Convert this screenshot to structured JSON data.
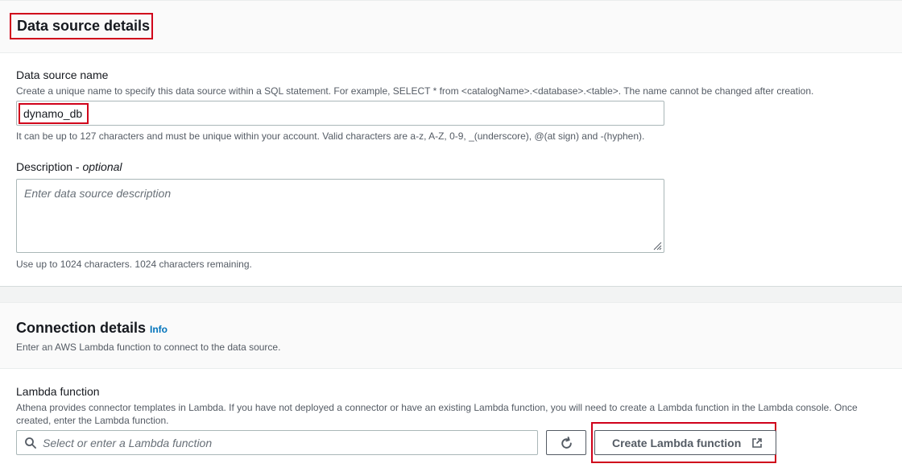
{
  "data_source_details": {
    "title": "Data source details",
    "name_label": "Data source name",
    "name_description": "Create a unique name to specify this data source within a SQL statement. For example, SELECT * from <catalogName>.<database>.<table>. The name cannot be changed after creation.",
    "name_value": "dynamo_db",
    "name_hint": "It can be up to 127 characters and must be unique within your account. Valid characters are a-z, A-Z, 0-9, _(underscore), @(at sign) and -(hyphen).",
    "description_label": "Description - ",
    "description_optional": "optional",
    "description_placeholder": "Enter data source description",
    "description_hint": "Use up to 1024 characters. 1024 characters remaining."
  },
  "connection_details": {
    "title": "Connection details",
    "info_link": "Info",
    "subtitle": "Enter an AWS Lambda function to connect to the data source.",
    "lambda_label": "Lambda function",
    "lambda_description": "Athena provides connector templates in Lambda. If you have not deployed a connector or have an existing Lambda function, you will need to create a Lambda function in the Lambda console. Once created, enter the Lambda function.",
    "lambda_placeholder": "Select or enter a Lambda function",
    "create_button_label": "Create Lambda function"
  },
  "icons": {
    "search": "search-icon",
    "refresh": "refresh-icon",
    "external_link": "external-link-icon",
    "resize": "resize-handle-icon"
  },
  "colors": {
    "highlight": "#d0021b",
    "link": "#0073bb"
  }
}
